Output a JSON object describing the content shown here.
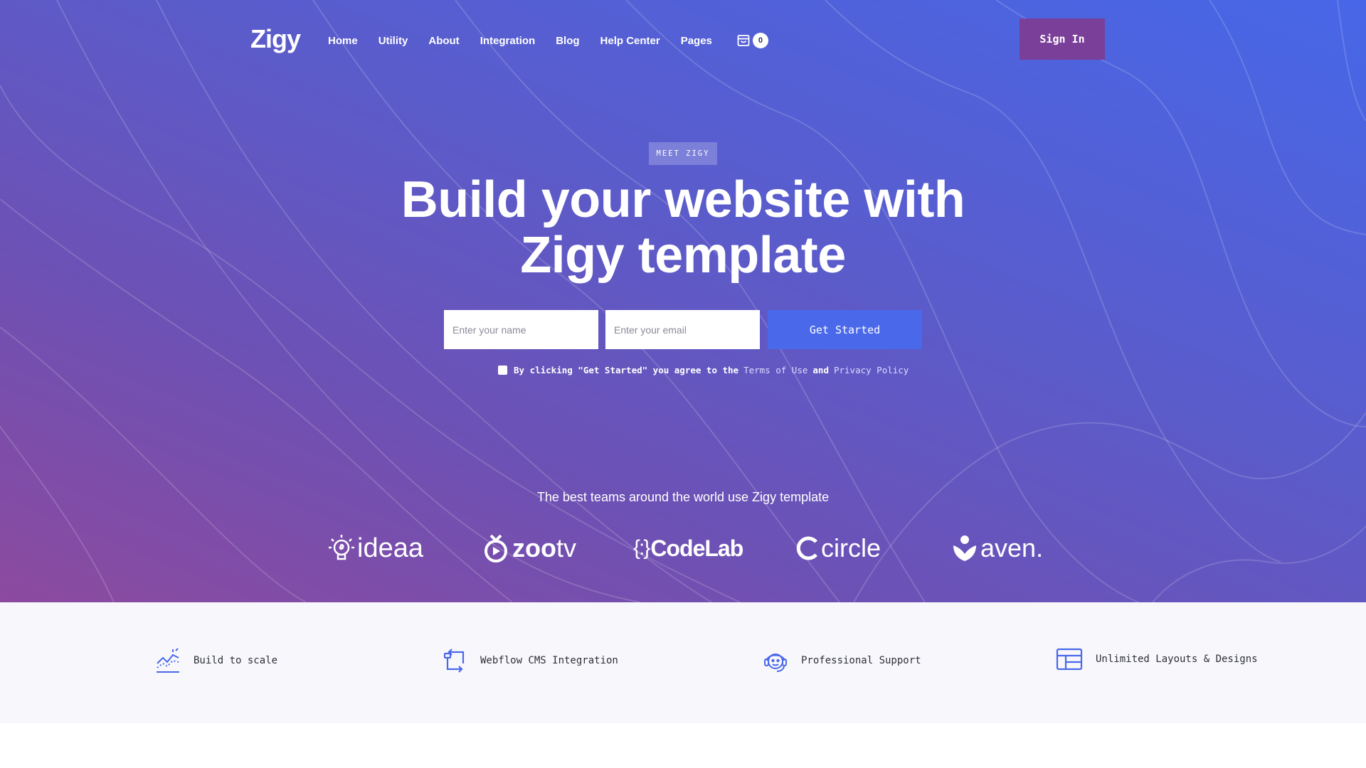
{
  "header": {
    "logo": "Zigy",
    "nav": [
      "Home",
      "Utility",
      "About",
      "Integration",
      "Blog",
      "Help Center",
      "Pages"
    ],
    "cart_count": "0",
    "signin_label": "Sign In"
  },
  "hero": {
    "eyebrow": "MEET ZIGY",
    "headline_line1": "Build your website with",
    "headline_line2": "Zigy template",
    "name_placeholder": "Enter your name",
    "email_placeholder": "Enter your email",
    "cta_label": "Get Started",
    "consent_text": "By clicking \"Get Started\" you agree to the",
    "terms_label": "Terms of Use",
    "and_label": "and",
    "privacy_label": "Privacy Policy"
  },
  "teams": {
    "title": "The best teams around the world use Zigy template",
    "brands": [
      "ideaa",
      "zoo",
      "tv",
      "{:}",
      "CodeLab",
      "circle",
      "aven."
    ]
  },
  "features": [
    {
      "label": "Build to scale",
      "icon": "chart-growth-icon"
    },
    {
      "label": "Webflow CMS Integration",
      "icon": "sync-arrows-icon"
    },
    {
      "label": "Professional Support",
      "icon": "support-agent-icon"
    },
    {
      "label": "Unlimited Layouts & Designs",
      "icon": "layout-grid-icon"
    }
  ],
  "colors": {
    "gradient_start": "#8c4a9f",
    "gradient_end": "#4767e8",
    "signin_bg": "#7a3f98",
    "cta_bg": "#4a68ea",
    "features_bg": "#f8f8fc"
  }
}
